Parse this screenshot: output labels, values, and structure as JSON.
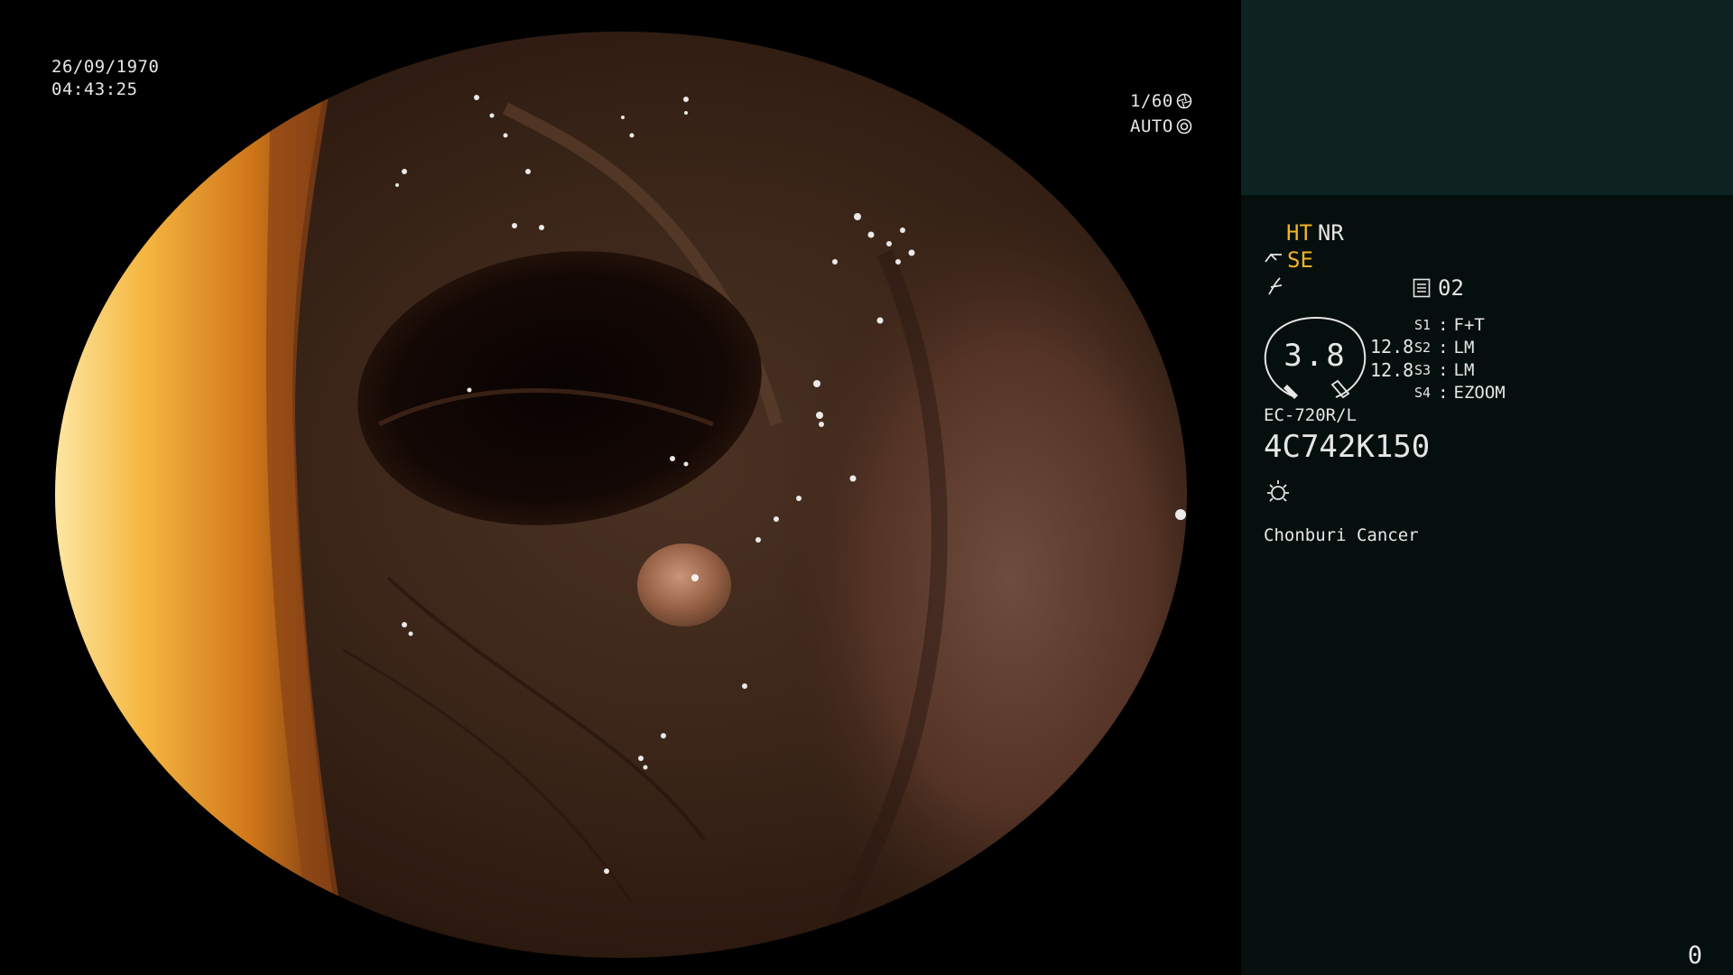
{
  "overlay": {
    "date": "26/09/1970",
    "time": "04:43:25",
    "shutter": "1/60",
    "mode": "AUTO"
  },
  "panel": {
    "ht": "HT",
    "nr": "NR",
    "se": "SE",
    "memory_value": "02",
    "gauge_value": "3.8",
    "gauge_side_top": "12.8",
    "gauge_side_bottom": "12.8",
    "switches": [
      {
        "key": "S1",
        "value": "F+T"
      },
      {
        "key": "S2",
        "value": "LM"
      },
      {
        "key": "S3",
        "value": "LM"
      },
      {
        "key": "S4",
        "value": "EZOOM"
      }
    ],
    "scope_model": "EC-720R/L",
    "serial": "4C742K150",
    "institution": "Chonburi Cancer",
    "counter": "0"
  },
  "colors": {
    "panel_bg": "#050f0d",
    "panel_top_bg": "#0c2322",
    "accent_amber": "#f1b228",
    "text": "#e6e6e6"
  },
  "icons": [
    "iris-icon",
    "light-icon",
    "scope-tip-icon",
    "freeze-icon",
    "memory-icon",
    "lamp-icon"
  ]
}
